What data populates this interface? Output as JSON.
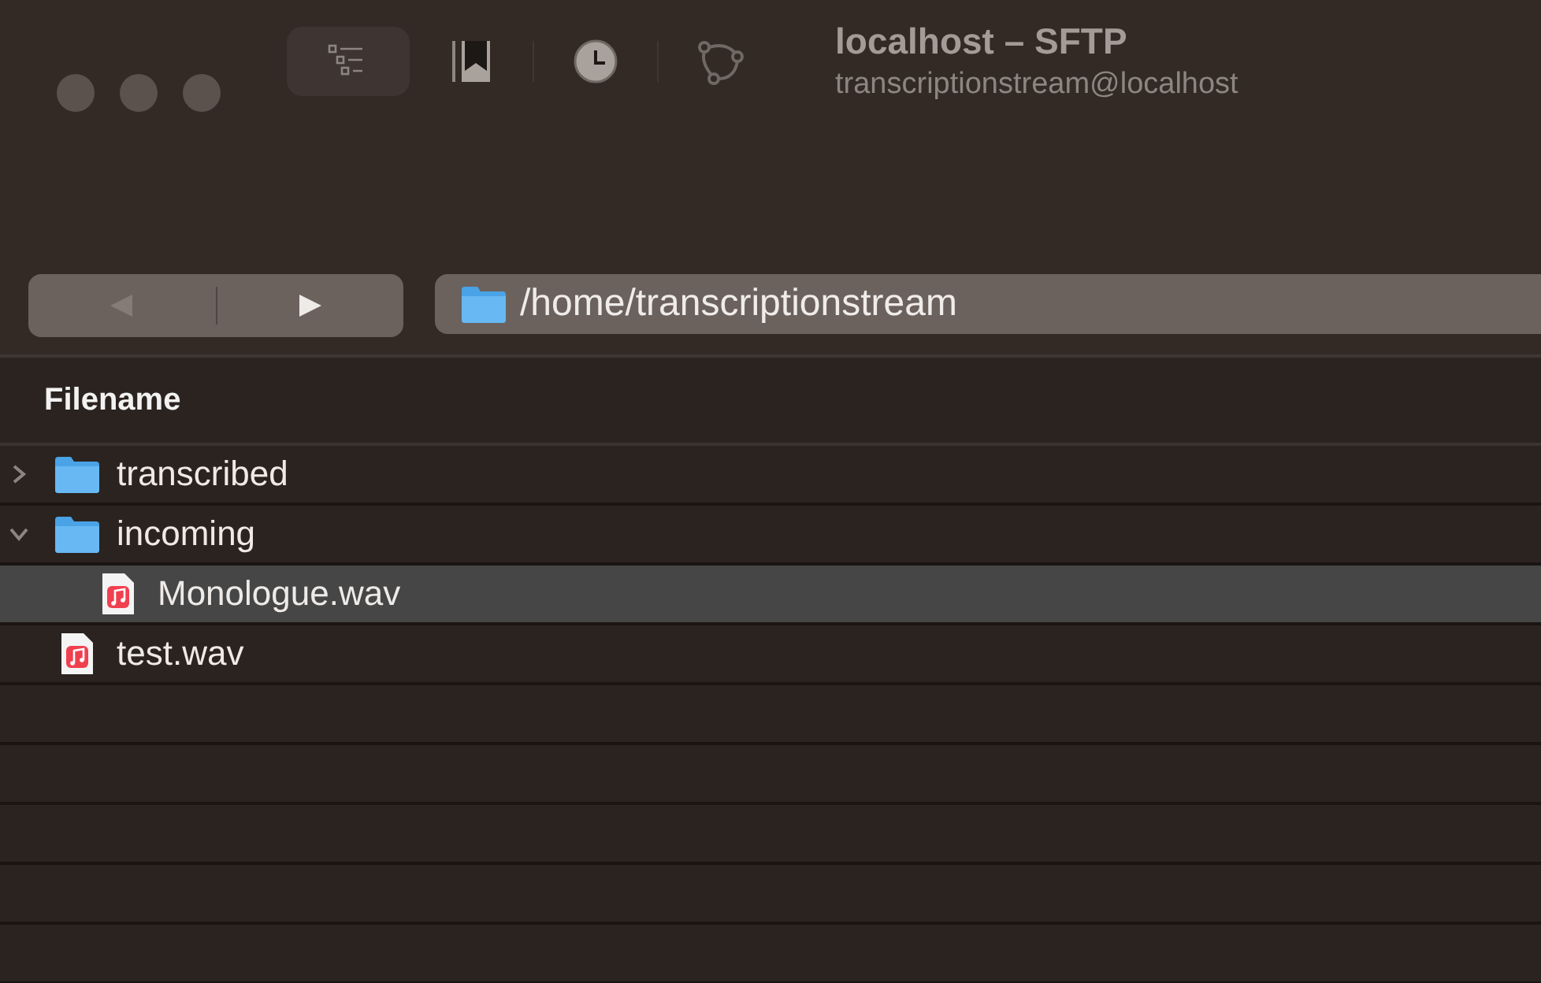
{
  "window": {
    "title": "localhost – SFTP",
    "subtitle": "transcriptionstream@localhost"
  },
  "toolbar": [
    {
      "kind": "outline",
      "selected": true
    },
    {
      "kind": "bookmarks",
      "selected": false
    },
    {
      "kind": "history",
      "selected": false
    },
    {
      "kind": "connections",
      "selected": false
    }
  ],
  "navigation": {
    "back": {
      "disabled": true
    },
    "forward": {
      "disabled": false
    },
    "path": "/home/transcriptionstream"
  },
  "table": {
    "columns": [
      "Filename"
    ],
    "rows": [
      {
        "kind": "folder",
        "name": "transcribed",
        "expanded": false,
        "selected": false
      },
      {
        "kind": "folder",
        "name": "incoming",
        "expanded": true,
        "selected": false,
        "children": [
          {
            "kind": "file",
            "name": "Monologue.wav",
            "selected": true
          }
        ]
      },
      {
        "kind": "file",
        "name": "test.wav",
        "selected": false
      }
    ]
  }
}
